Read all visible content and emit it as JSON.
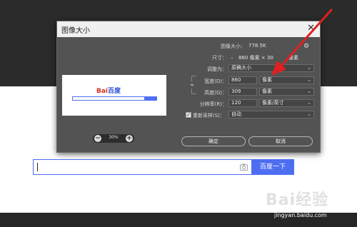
{
  "background": {
    "search_button": "百度一下"
  },
  "dialog": {
    "title": "图像大小",
    "close": "✕",
    "image_size_label": "图像大小：",
    "image_size_value": "778.5K",
    "dimensions_label": "尺寸：",
    "dimensions_value": "860 像素 × 30",
    "dimensions_tail": "像素",
    "fit_label": "调整为：",
    "fit_value": "原稿大小",
    "width_label": "宽度(D)：",
    "width_value": "860",
    "width_unit": "像素",
    "height_label": "高度(G)：",
    "height_value": "309",
    "height_unit": "像素",
    "resolution_label": "分辨率(R)：",
    "resolution_value": "120",
    "resolution_unit": "像素/英寸",
    "resample_label": "重新采样(S)：",
    "resample_value": "自动",
    "zoom_value": "30%",
    "ok_label": "确定",
    "cancel_label": "取消",
    "preview_logo_a": "Bai",
    "preview_logo_b": "百度"
  },
  "watermark": {
    "logo": "Bai经验",
    "url": "jingyan.baidu.com"
  },
  "colors": {
    "arrow": "#e02020",
    "accent": "#4e6ef2"
  }
}
